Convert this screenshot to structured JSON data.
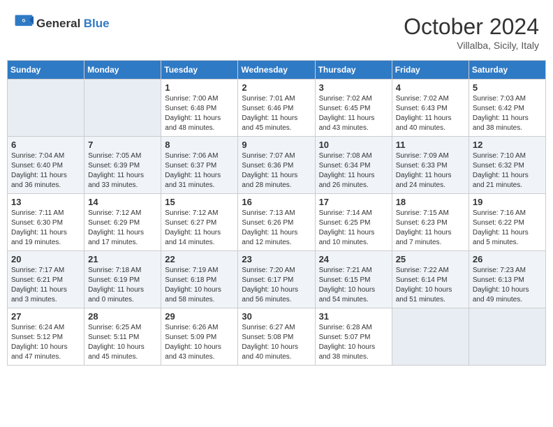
{
  "header": {
    "logo_general": "General",
    "logo_blue": "Blue",
    "month_title": "October 2024",
    "location": "Villalba, Sicily, Italy"
  },
  "weekdays": [
    "Sunday",
    "Monday",
    "Tuesday",
    "Wednesday",
    "Thursday",
    "Friday",
    "Saturday"
  ],
  "weeks": [
    [
      {
        "day": "",
        "info": ""
      },
      {
        "day": "",
        "info": ""
      },
      {
        "day": "1",
        "info": "Sunrise: 7:00 AM\nSunset: 6:48 PM\nDaylight: 11 hours and 48 minutes."
      },
      {
        "day": "2",
        "info": "Sunrise: 7:01 AM\nSunset: 6:46 PM\nDaylight: 11 hours and 45 minutes."
      },
      {
        "day": "3",
        "info": "Sunrise: 7:02 AM\nSunset: 6:45 PM\nDaylight: 11 hours and 43 minutes."
      },
      {
        "day": "4",
        "info": "Sunrise: 7:02 AM\nSunset: 6:43 PM\nDaylight: 11 hours and 40 minutes."
      },
      {
        "day": "5",
        "info": "Sunrise: 7:03 AM\nSunset: 6:42 PM\nDaylight: 11 hours and 38 minutes."
      }
    ],
    [
      {
        "day": "6",
        "info": "Sunrise: 7:04 AM\nSunset: 6:40 PM\nDaylight: 11 hours and 36 minutes."
      },
      {
        "day": "7",
        "info": "Sunrise: 7:05 AM\nSunset: 6:39 PM\nDaylight: 11 hours and 33 minutes."
      },
      {
        "day": "8",
        "info": "Sunrise: 7:06 AM\nSunset: 6:37 PM\nDaylight: 11 hours and 31 minutes."
      },
      {
        "day": "9",
        "info": "Sunrise: 7:07 AM\nSunset: 6:36 PM\nDaylight: 11 hours and 28 minutes."
      },
      {
        "day": "10",
        "info": "Sunrise: 7:08 AM\nSunset: 6:34 PM\nDaylight: 11 hours and 26 minutes."
      },
      {
        "day": "11",
        "info": "Sunrise: 7:09 AM\nSunset: 6:33 PM\nDaylight: 11 hours and 24 minutes."
      },
      {
        "day": "12",
        "info": "Sunrise: 7:10 AM\nSunset: 6:32 PM\nDaylight: 11 hours and 21 minutes."
      }
    ],
    [
      {
        "day": "13",
        "info": "Sunrise: 7:11 AM\nSunset: 6:30 PM\nDaylight: 11 hours and 19 minutes."
      },
      {
        "day": "14",
        "info": "Sunrise: 7:12 AM\nSunset: 6:29 PM\nDaylight: 11 hours and 17 minutes."
      },
      {
        "day": "15",
        "info": "Sunrise: 7:12 AM\nSunset: 6:27 PM\nDaylight: 11 hours and 14 minutes."
      },
      {
        "day": "16",
        "info": "Sunrise: 7:13 AM\nSunset: 6:26 PM\nDaylight: 11 hours and 12 minutes."
      },
      {
        "day": "17",
        "info": "Sunrise: 7:14 AM\nSunset: 6:25 PM\nDaylight: 11 hours and 10 minutes."
      },
      {
        "day": "18",
        "info": "Sunrise: 7:15 AM\nSunset: 6:23 PM\nDaylight: 11 hours and 7 minutes."
      },
      {
        "day": "19",
        "info": "Sunrise: 7:16 AM\nSunset: 6:22 PM\nDaylight: 11 hours and 5 minutes."
      }
    ],
    [
      {
        "day": "20",
        "info": "Sunrise: 7:17 AM\nSunset: 6:21 PM\nDaylight: 11 hours and 3 minutes."
      },
      {
        "day": "21",
        "info": "Sunrise: 7:18 AM\nSunset: 6:19 PM\nDaylight: 11 hours and 0 minutes."
      },
      {
        "day": "22",
        "info": "Sunrise: 7:19 AM\nSunset: 6:18 PM\nDaylight: 10 hours and 58 minutes."
      },
      {
        "day": "23",
        "info": "Sunrise: 7:20 AM\nSunset: 6:17 PM\nDaylight: 10 hours and 56 minutes."
      },
      {
        "day": "24",
        "info": "Sunrise: 7:21 AM\nSunset: 6:15 PM\nDaylight: 10 hours and 54 minutes."
      },
      {
        "day": "25",
        "info": "Sunrise: 7:22 AM\nSunset: 6:14 PM\nDaylight: 10 hours and 51 minutes."
      },
      {
        "day": "26",
        "info": "Sunrise: 7:23 AM\nSunset: 6:13 PM\nDaylight: 10 hours and 49 minutes."
      }
    ],
    [
      {
        "day": "27",
        "info": "Sunrise: 6:24 AM\nSunset: 5:12 PM\nDaylight: 10 hours and 47 minutes."
      },
      {
        "day": "28",
        "info": "Sunrise: 6:25 AM\nSunset: 5:11 PM\nDaylight: 10 hours and 45 minutes."
      },
      {
        "day": "29",
        "info": "Sunrise: 6:26 AM\nSunset: 5:09 PM\nDaylight: 10 hours and 43 minutes."
      },
      {
        "day": "30",
        "info": "Sunrise: 6:27 AM\nSunset: 5:08 PM\nDaylight: 10 hours and 40 minutes."
      },
      {
        "day": "31",
        "info": "Sunrise: 6:28 AM\nSunset: 5:07 PM\nDaylight: 10 hours and 38 minutes."
      },
      {
        "day": "",
        "info": ""
      },
      {
        "day": "",
        "info": ""
      }
    ]
  ]
}
